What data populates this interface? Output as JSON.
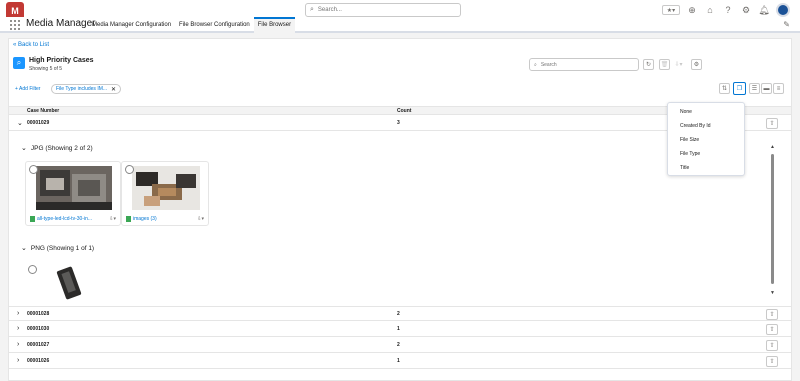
{
  "topbar": {
    "logo_text": "M",
    "search_placeholder": "Search..."
  },
  "nav": {
    "app_name": "Media Manager",
    "tabs": [
      {
        "label": "Media Manager Configuration"
      },
      {
        "label": "File Browser Configuration"
      },
      {
        "label": "File Browser"
      }
    ],
    "active_tab": "File Browser"
  },
  "page": {
    "back_link": "« Back to List",
    "title": "High Priority Cases",
    "subtitle": "Showing 5 of 5",
    "search_placeholder": "Search",
    "add_filter": "+ Add Filter",
    "filter_pill": "File Type includes IM...",
    "columns": {
      "case_number": "Case Number",
      "count": "Count"
    }
  },
  "rows": [
    {
      "case": "00001029",
      "count": "3",
      "expanded": true
    },
    {
      "case": "00001028",
      "count": "2"
    },
    {
      "case": "00001030",
      "count": "1"
    },
    {
      "case": "00001027",
      "count": "2"
    },
    {
      "case": "00001026",
      "count": "1"
    }
  ],
  "groups": {
    "jpg": {
      "label": "JPG (Showing 2 of 2)",
      "files": [
        {
          "name": "all-type-led-lcd-tv-30-in..."
        },
        {
          "name": "images (3)"
        }
      ]
    },
    "png": {
      "label": "PNG (Showing 1 of 1)"
    }
  },
  "group_by_menu": {
    "options": [
      "None",
      "Created By Id",
      "File Size",
      "File Type",
      "Title"
    ]
  },
  "colors": {
    "brand": "#c23934",
    "accent": "#0176d3",
    "file_icon": "#3ba755"
  }
}
